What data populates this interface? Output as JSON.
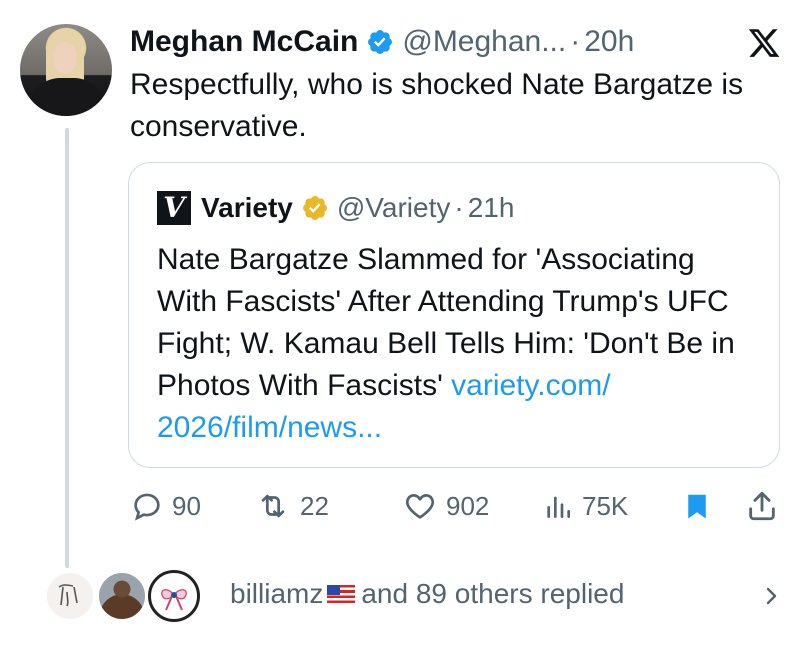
{
  "post": {
    "author_name": "Meghan McCain",
    "handle": "@Meghan...",
    "separator": "·",
    "time": "20h",
    "text": "Respectfully, who is shocked Nate Bargatze is conservative."
  },
  "quote": {
    "author_name": "Variety",
    "logo_letter": "V",
    "handle": "@Variety",
    "separator": "·",
    "time": "21h",
    "text": "Nate Bargatze Slammed for 'Associating With Fascists' After Attending Trump's UFC Fight; W. Kamau Bell Tells Him: 'Don't Be in Photos With Fascists' ",
    "link": "variety.com/ 2026/film/news..."
  },
  "actions": {
    "replies": "90",
    "reposts": "22",
    "likes": "902",
    "views": "75K"
  },
  "replies_summary": {
    "user": "billiamz",
    "rest": "and 89 others replied"
  },
  "colors": {
    "accent": "#1d9bf0",
    "secondary_text": "#536471",
    "verified_gold": "#e8b829",
    "border": "#cfd9de"
  },
  "icons": [
    "verified-badge-icon",
    "x-logo-icon",
    "gold-verified-icon",
    "reply-icon",
    "repost-icon",
    "like-icon",
    "views-icon",
    "bookmark-icon",
    "share-icon",
    "chevron-right-icon",
    "us-flag-icon"
  ]
}
